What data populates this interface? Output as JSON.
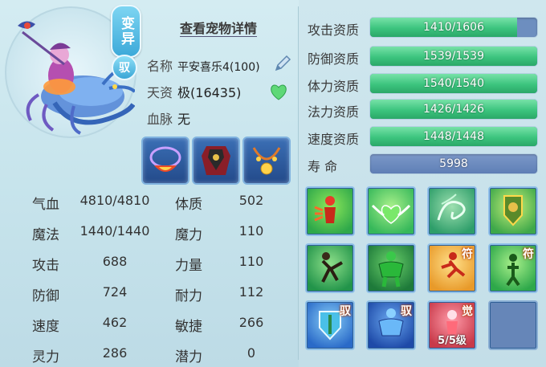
{
  "header": {
    "variant_badge": "变异",
    "ride_badge": "驭",
    "detail_link": "查看宠物详情"
  },
  "info": {
    "name_label": "名称",
    "name_value": "平安喜乐4(100)",
    "aptitude_label": "天资",
    "aptitude_value": "极(16435)",
    "bloodline_label": "血脉",
    "bloodline_value": "无"
  },
  "stats": [
    {
      "label": "气血",
      "value": "4810/4810",
      "label2": "体质",
      "value2": "502"
    },
    {
      "label": "魔法",
      "value": "1440/1440",
      "label2": "魔力",
      "value2": "110"
    },
    {
      "label": "攻击",
      "value": "688",
      "label2": "力量",
      "value2": "110"
    },
    {
      "label": "防御",
      "value": "724",
      "label2": "耐力",
      "value2": "112"
    },
    {
      "label": "速度",
      "value": "462",
      "label2": "敏捷",
      "value2": "266"
    },
    {
      "label": "灵力",
      "value": "286",
      "label2": "潜力",
      "value2": "0"
    }
  ],
  "qualities": [
    {
      "label": "攻击资质",
      "text": "1410/1606",
      "current": 1410,
      "max": 1606
    },
    {
      "label": "防御资质",
      "text": "1539/1539",
      "current": 1539,
      "max": 1539
    },
    {
      "label": "体力资质",
      "text": "1540/1540",
      "current": 1540,
      "max": 1540
    },
    {
      "label": "法力资质",
      "text": "1426/1426",
      "current": 1426,
      "max": 1426
    },
    {
      "label": "速度资质",
      "text": "1448/1448",
      "current": 1448,
      "max": 1448
    }
  ],
  "lifespan": {
    "label": "寿    命",
    "value": "5998"
  },
  "skills": [
    {
      "icon": "red-runner-skill-icon",
      "tag": "",
      "level": ""
    },
    {
      "icon": "winged-heart-skill-icon",
      "tag": "",
      "level": ""
    },
    {
      "icon": "green-swirl-skill-icon",
      "tag": "",
      "level": ""
    },
    {
      "icon": "shield-banner-skill-icon",
      "tag": "",
      "level": ""
    },
    {
      "icon": "green-kick-skill-icon",
      "tag": "",
      "level": ""
    },
    {
      "icon": "muscle-skill-icon",
      "tag": "",
      "level": ""
    },
    {
      "icon": "red-dash-skill-icon",
      "tag": "符",
      "level": ""
    },
    {
      "icon": "green-figure-skill-icon",
      "tag": "符",
      "level": ""
    },
    {
      "icon": "blue-shield-skill-icon",
      "tag": "驭",
      "level": ""
    },
    {
      "icon": "blue-giant-skill-icon",
      "tag": "驭",
      "level": ""
    },
    {
      "icon": "awaken-figure-skill-icon",
      "tag": "觉",
      "level": "5/5级"
    },
    {
      "icon": "empty-skill-slot",
      "tag": "",
      "level": ""
    }
  ],
  "colors": {
    "quality_fill": "#3cc47e",
    "quality_track": "#6d8ebf",
    "badge_blue": "#3ca9d9",
    "tag_orange": "#b03a00"
  }
}
